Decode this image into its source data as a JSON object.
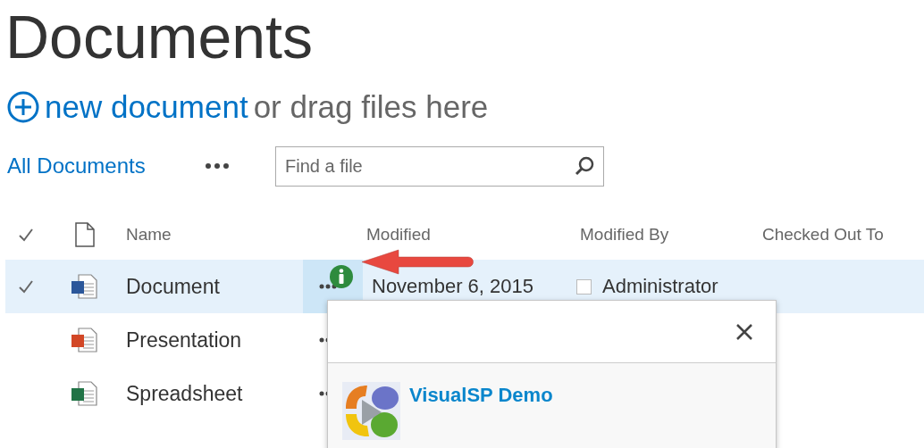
{
  "title": "Documents",
  "new_document": {
    "link": "new document",
    "hint": "or drag files here"
  },
  "view": {
    "label": "All Documents"
  },
  "search": {
    "placeholder": "Find a file"
  },
  "columns": [
    "Name",
    "Modified",
    "Modified By",
    "Checked Out To"
  ],
  "rows": [
    {
      "kind": "word",
      "name": "Document",
      "selected": true,
      "modified": "November 6, 2015",
      "modified_by": "Administrator"
    },
    {
      "kind": "powerpoint",
      "name": "Presentation",
      "selected": false
    },
    {
      "kind": "excel",
      "name": "Spreadsheet",
      "selected": false
    }
  ],
  "popup": {
    "title": "VisualSP Demo"
  }
}
